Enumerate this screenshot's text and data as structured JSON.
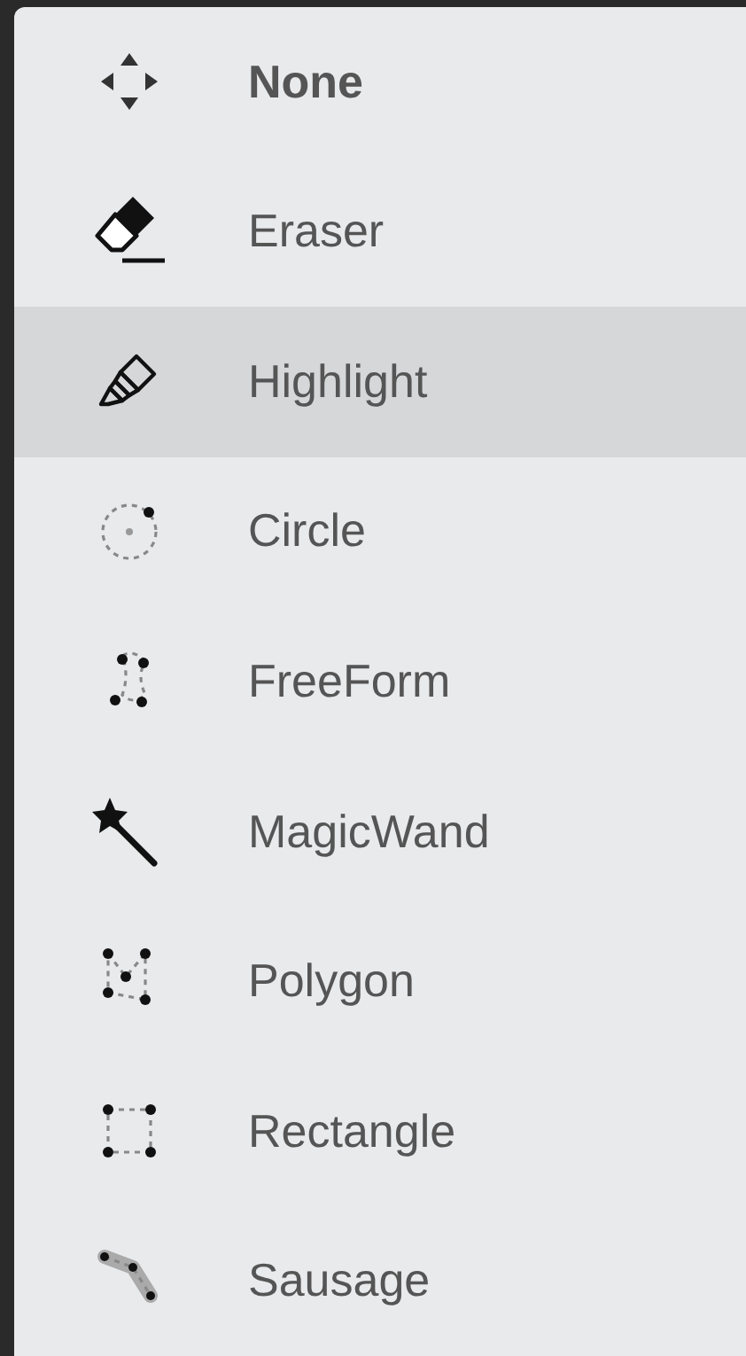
{
  "menu": {
    "items": [
      {
        "label": "None",
        "kind": "move",
        "selected": false,
        "bold": true
      },
      {
        "label": "Eraser",
        "kind": "eraser",
        "selected": false,
        "bold": false
      },
      {
        "label": "Highlight",
        "kind": "highlight",
        "selected": true,
        "bold": false
      },
      {
        "label": "Circle",
        "kind": "circle",
        "selected": false,
        "bold": false
      },
      {
        "label": "FreeForm",
        "kind": "freeform",
        "selected": false,
        "bold": false
      },
      {
        "label": "MagicWand",
        "kind": "wand",
        "selected": false,
        "bold": false
      },
      {
        "label": "Polygon",
        "kind": "polygon",
        "selected": false,
        "bold": false
      },
      {
        "label": "Rectangle",
        "kind": "rectangle",
        "selected": false,
        "bold": false
      },
      {
        "label": "Sausage",
        "kind": "sausage",
        "selected": false,
        "bold": false
      }
    ]
  }
}
